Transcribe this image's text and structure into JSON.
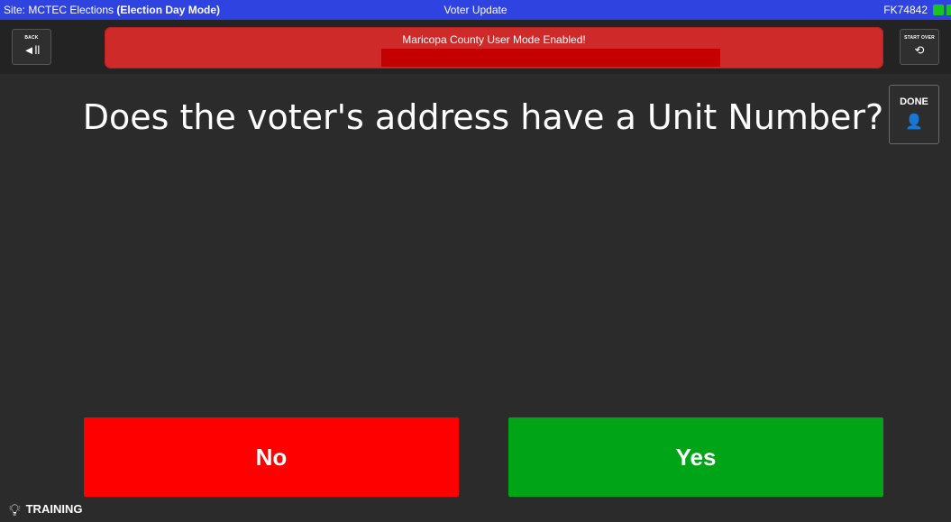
{
  "topbar": {
    "site_prefix": "Site: MCTEC Elections ",
    "mode": "(Election Day Mode)",
    "title": "Voter Update",
    "device_id": "FK74842"
  },
  "toolbar": {
    "back_label": "BACK",
    "back_icon": "◄ll",
    "start_over_label": "START OVER",
    "start_over_icon": "⟲",
    "banner_text": "Maricopa County User Mode Enabled!"
  },
  "main": {
    "question": "Does the voter's address have a Unit Number?",
    "done_label": "DONE",
    "done_icon": "👤",
    "no_label": "No",
    "yes_label": "Yes"
  },
  "footer": {
    "training_label": "TRAINING"
  },
  "colors": {
    "topbar": "#2e43e0",
    "banner": "#cf2a2a",
    "no": "#ff0000",
    "yes": "#00a417",
    "background": "#2b2b2b"
  }
}
